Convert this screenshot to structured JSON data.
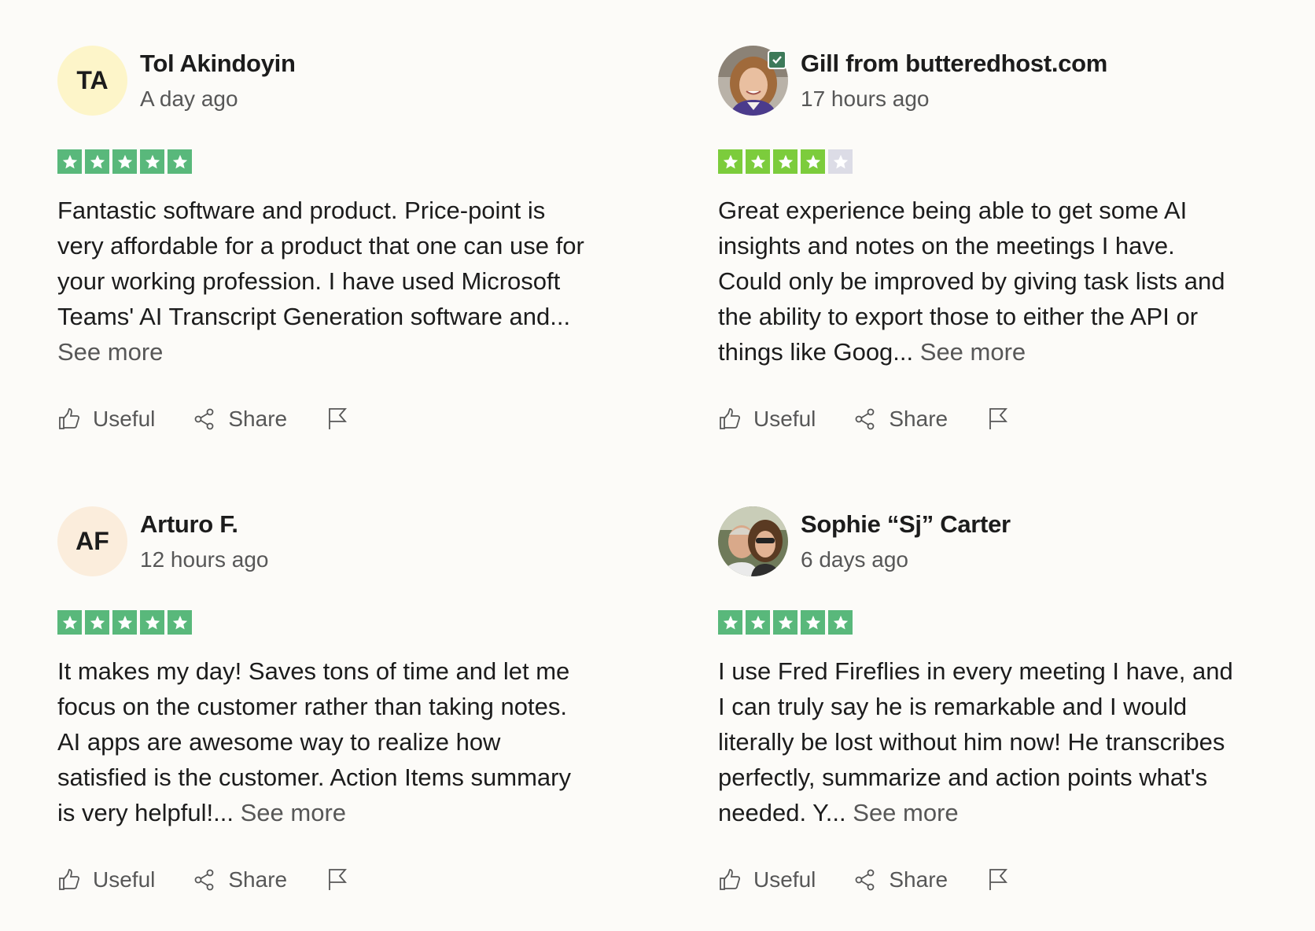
{
  "colors": {
    "star_green": "#59b87b",
    "star_light_green": "#7ccc3c",
    "star_empty": "#dcdce6",
    "avatar_ta": "#fdf5c9",
    "avatar_af": "#fbeddc",
    "verified": "#3d7a5a"
  },
  "reviews": [
    {
      "initials": "TA",
      "name": "Tol Akindoyin",
      "time": "A day ago",
      "rating": 5,
      "text": "Fantastic software and product. Price-point is very affordable for a product that one can use for your working profession. I have used Microsoft Teams' AI Transcript Generation software and...",
      "see_more": "See more",
      "useful": "Useful",
      "share": "Share"
    },
    {
      "initials": "",
      "name": "Gill from butteredhost.com",
      "time": "17 hours ago",
      "rating": 4,
      "text": "Great experience being able to get some AI insights and notes on the meetings I have. Could only be improved by giving task lists and the ability to export those to either the API or things like Goog...",
      "see_more": "See more",
      "useful": "Useful",
      "share": "Share"
    },
    {
      "initials": "AF",
      "name": "Arturo F.",
      "time": "12 hours ago",
      "rating": 5,
      "text": "It makes my day! Saves tons of time and let me focus on the customer rather than taking notes. AI apps are awesome way to realize how satisfied is the customer. Action Items summary is very helpful!...",
      "see_more": "See more",
      "useful": "Useful",
      "share": "Share"
    },
    {
      "initials": "",
      "name": "Sophie “Sj” Carter",
      "time": "6 days ago",
      "rating": 5,
      "text": "I use Fred Fireflies in every meeting I have, and I can truly say he is remarkable and I would literally be lost without him now! He transcribes perfectly, summarize and action points what's needed. Y...",
      "see_more": "See more",
      "useful": "Useful",
      "share": "Share"
    }
  ]
}
